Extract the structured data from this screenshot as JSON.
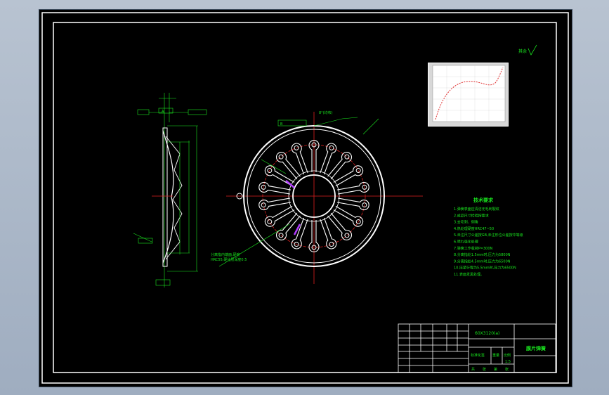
{
  "drawing": {
    "title_block": {
      "title": "膜片弹簧",
      "drawing_number": "60X3120(a)",
      "material_label": "标准化签",
      "scale_label": "比例",
      "scale_value": "1:5",
      "weight_label": "重量",
      "sheet_labels": [
        "共",
        "张",
        "第",
        "张"
      ]
    },
    "roughness_mark": "其余",
    "tech_requirements": {
      "title": "技术要求",
      "items": [
        "1.弹簧表面应清洁无毛刺裂纹",
        "2.成品尺寸检验按要求",
        "3.去毛刺、倒角",
        "4.热处理硬度HRC47~50",
        "5.未注尺寸公差按GB,未注形位公差按中等级",
        "6.喷丸强化处理",
        "7.弹簧工作载荷P=300N",
        "8.分离指处1.5mm时,压力为5800N",
        "9.分离指处4.5mm时,压力为6500N",
        "10.压紧行程为5.5mm时,压力为6500N",
        "11.表面发黑处理。"
      ]
    },
    "annotations": {
      "angle_label": "8°(均布)",
      "datum_a": "A",
      "datum_b": "B",
      "callout": "分离指内端面,硬度",
      "callout_line2": "HRC55,硬化层深度0.5"
    }
  },
  "colors": {
    "line": "#19e61e",
    "outline": "#ffffff",
    "center_line": "#e02020",
    "highlight": "#b23cff",
    "background": "#000000"
  }
}
